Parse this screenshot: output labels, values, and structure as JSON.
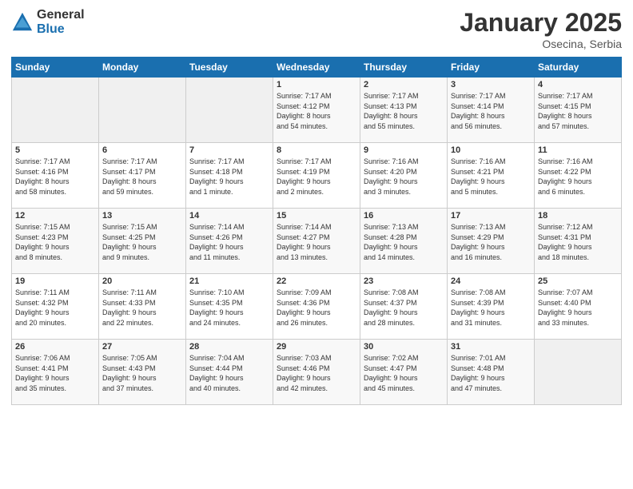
{
  "header": {
    "logo_general": "General",
    "logo_blue": "Blue",
    "month": "January 2025",
    "location": "Osecina, Serbia"
  },
  "weekdays": [
    "Sunday",
    "Monday",
    "Tuesday",
    "Wednesday",
    "Thursday",
    "Friday",
    "Saturday"
  ],
  "weeks": [
    [
      {
        "day": "",
        "info": ""
      },
      {
        "day": "",
        "info": ""
      },
      {
        "day": "",
        "info": ""
      },
      {
        "day": "1",
        "info": "Sunrise: 7:17 AM\nSunset: 4:12 PM\nDaylight: 8 hours\nand 54 minutes."
      },
      {
        "day": "2",
        "info": "Sunrise: 7:17 AM\nSunset: 4:13 PM\nDaylight: 8 hours\nand 55 minutes."
      },
      {
        "day": "3",
        "info": "Sunrise: 7:17 AM\nSunset: 4:14 PM\nDaylight: 8 hours\nand 56 minutes."
      },
      {
        "day": "4",
        "info": "Sunrise: 7:17 AM\nSunset: 4:15 PM\nDaylight: 8 hours\nand 57 minutes."
      }
    ],
    [
      {
        "day": "5",
        "info": "Sunrise: 7:17 AM\nSunset: 4:16 PM\nDaylight: 8 hours\nand 58 minutes."
      },
      {
        "day": "6",
        "info": "Sunrise: 7:17 AM\nSunset: 4:17 PM\nDaylight: 8 hours\nand 59 minutes."
      },
      {
        "day": "7",
        "info": "Sunrise: 7:17 AM\nSunset: 4:18 PM\nDaylight: 9 hours\nand 1 minute."
      },
      {
        "day": "8",
        "info": "Sunrise: 7:17 AM\nSunset: 4:19 PM\nDaylight: 9 hours\nand 2 minutes."
      },
      {
        "day": "9",
        "info": "Sunrise: 7:16 AM\nSunset: 4:20 PM\nDaylight: 9 hours\nand 3 minutes."
      },
      {
        "day": "10",
        "info": "Sunrise: 7:16 AM\nSunset: 4:21 PM\nDaylight: 9 hours\nand 5 minutes."
      },
      {
        "day": "11",
        "info": "Sunrise: 7:16 AM\nSunset: 4:22 PM\nDaylight: 9 hours\nand 6 minutes."
      }
    ],
    [
      {
        "day": "12",
        "info": "Sunrise: 7:15 AM\nSunset: 4:23 PM\nDaylight: 9 hours\nand 8 minutes."
      },
      {
        "day": "13",
        "info": "Sunrise: 7:15 AM\nSunset: 4:25 PM\nDaylight: 9 hours\nand 9 minutes."
      },
      {
        "day": "14",
        "info": "Sunrise: 7:14 AM\nSunset: 4:26 PM\nDaylight: 9 hours\nand 11 minutes."
      },
      {
        "day": "15",
        "info": "Sunrise: 7:14 AM\nSunset: 4:27 PM\nDaylight: 9 hours\nand 13 minutes."
      },
      {
        "day": "16",
        "info": "Sunrise: 7:13 AM\nSunset: 4:28 PM\nDaylight: 9 hours\nand 14 minutes."
      },
      {
        "day": "17",
        "info": "Sunrise: 7:13 AM\nSunset: 4:29 PM\nDaylight: 9 hours\nand 16 minutes."
      },
      {
        "day": "18",
        "info": "Sunrise: 7:12 AM\nSunset: 4:31 PM\nDaylight: 9 hours\nand 18 minutes."
      }
    ],
    [
      {
        "day": "19",
        "info": "Sunrise: 7:11 AM\nSunset: 4:32 PM\nDaylight: 9 hours\nand 20 minutes."
      },
      {
        "day": "20",
        "info": "Sunrise: 7:11 AM\nSunset: 4:33 PM\nDaylight: 9 hours\nand 22 minutes."
      },
      {
        "day": "21",
        "info": "Sunrise: 7:10 AM\nSunset: 4:35 PM\nDaylight: 9 hours\nand 24 minutes."
      },
      {
        "day": "22",
        "info": "Sunrise: 7:09 AM\nSunset: 4:36 PM\nDaylight: 9 hours\nand 26 minutes."
      },
      {
        "day": "23",
        "info": "Sunrise: 7:08 AM\nSunset: 4:37 PM\nDaylight: 9 hours\nand 28 minutes."
      },
      {
        "day": "24",
        "info": "Sunrise: 7:08 AM\nSunset: 4:39 PM\nDaylight: 9 hours\nand 31 minutes."
      },
      {
        "day": "25",
        "info": "Sunrise: 7:07 AM\nSunset: 4:40 PM\nDaylight: 9 hours\nand 33 minutes."
      }
    ],
    [
      {
        "day": "26",
        "info": "Sunrise: 7:06 AM\nSunset: 4:41 PM\nDaylight: 9 hours\nand 35 minutes."
      },
      {
        "day": "27",
        "info": "Sunrise: 7:05 AM\nSunset: 4:43 PM\nDaylight: 9 hours\nand 37 minutes."
      },
      {
        "day": "28",
        "info": "Sunrise: 7:04 AM\nSunset: 4:44 PM\nDaylight: 9 hours\nand 40 minutes."
      },
      {
        "day": "29",
        "info": "Sunrise: 7:03 AM\nSunset: 4:46 PM\nDaylight: 9 hours\nand 42 minutes."
      },
      {
        "day": "30",
        "info": "Sunrise: 7:02 AM\nSunset: 4:47 PM\nDaylight: 9 hours\nand 45 minutes."
      },
      {
        "day": "31",
        "info": "Sunrise: 7:01 AM\nSunset: 4:48 PM\nDaylight: 9 hours\nand 47 minutes."
      },
      {
        "day": "",
        "info": ""
      }
    ]
  ]
}
